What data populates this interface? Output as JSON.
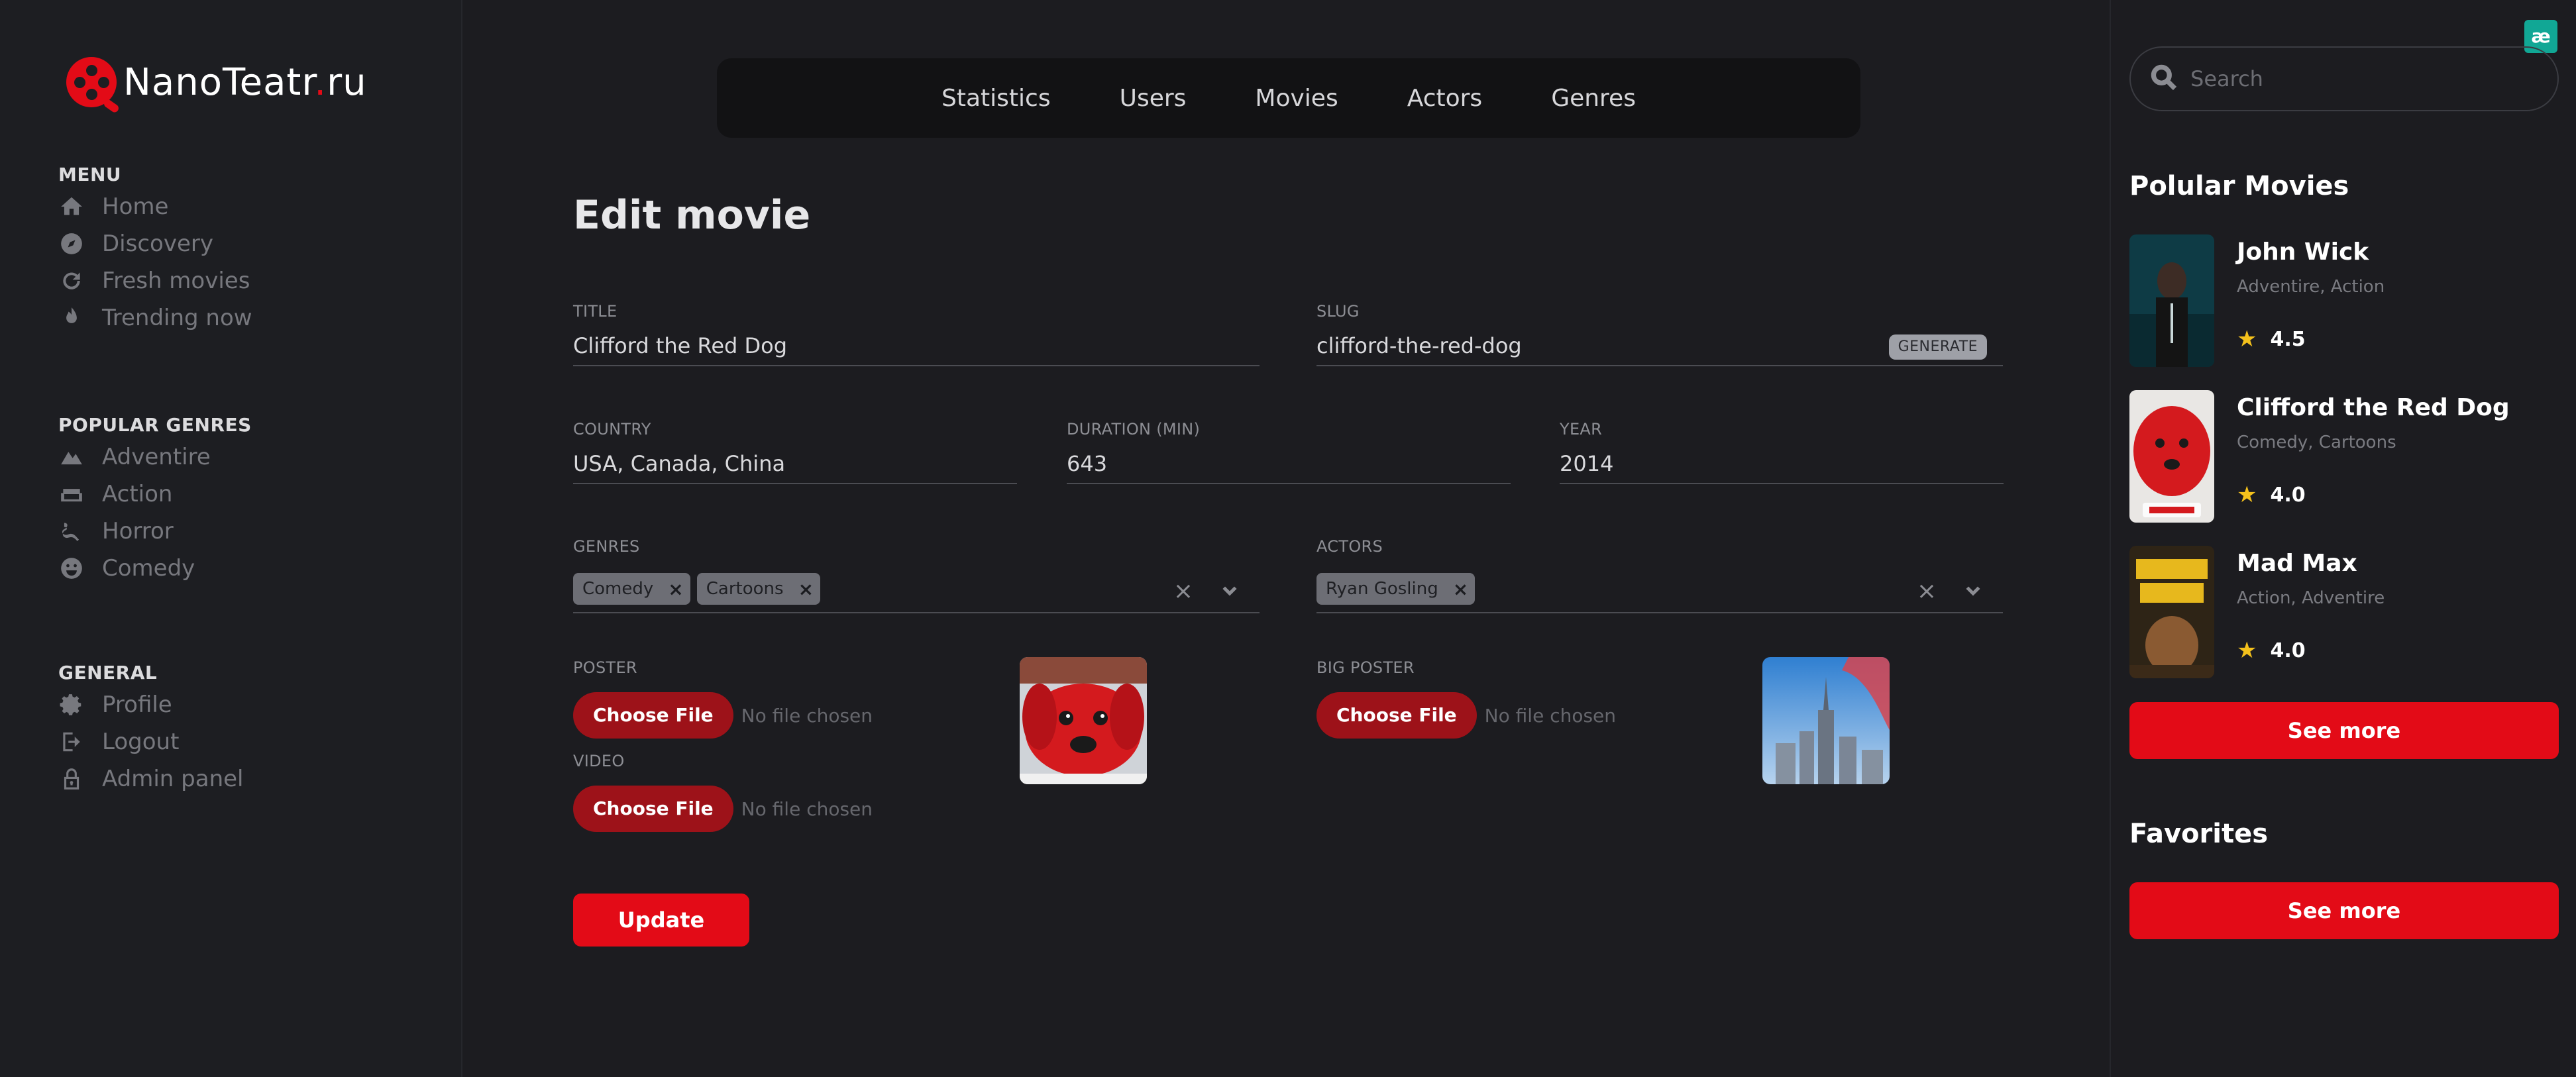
{
  "logo": {
    "name": "NanoTeatr",
    "dot": ".",
    "tld": "ru"
  },
  "sidebar": {
    "menu_heading": "MENU",
    "menu_items": [
      {
        "label": "Home",
        "icon": "home-icon"
      },
      {
        "label": "Discovery",
        "icon": "compass-icon"
      },
      {
        "label": "Fresh movies",
        "icon": "refresh-icon"
      },
      {
        "label": "Trending now",
        "icon": "fire-icon"
      }
    ],
    "genres_heading": "POPULAR GENRES",
    "genre_items": [
      {
        "label": "Adventire",
        "icon": "mountain-icon"
      },
      {
        "label": "Action",
        "icon": "couch-icon"
      },
      {
        "label": "Horror",
        "icon": "squiggle-icon"
      },
      {
        "label": "Comedy",
        "icon": "smile-icon"
      }
    ],
    "general_heading": "GENERAL",
    "general_items": [
      {
        "label": "Profile",
        "icon": "gear-icon"
      },
      {
        "label": "Logout",
        "icon": "logout-icon"
      },
      {
        "label": "Admin panel",
        "icon": "lock-icon"
      }
    ]
  },
  "top_nav": [
    "Statistics",
    "Users",
    "Movies",
    "Actors",
    "Genres"
  ],
  "form": {
    "page_title": "Edit movie",
    "title_label": "TITLE",
    "title_value": "Clifford the Red Dog",
    "slug_label": "SLUG",
    "slug_value": "clifford-the-red-dog",
    "generate_label": "GENERATE",
    "country_label": "COUNTRY",
    "country_value": "USA, Canada, China",
    "duration_label": "DURATION (MIN)",
    "duration_value": "643",
    "year_label": "YEAR",
    "year_value": "2014",
    "genres_label": "GENRES",
    "genres_chips": [
      "Comedy",
      "Cartoons"
    ],
    "actors_label": "ACTORS",
    "actors_chips": [
      "Ryan Gosling"
    ],
    "chip_remove": "×",
    "clear_glyph": "×",
    "poster_label": "POSTER",
    "big_poster_label": "BIG POSTER",
    "video_label": "VIDEO",
    "choose_file": "Choose File",
    "no_file": "No file chosen",
    "update_label": "Update"
  },
  "right": {
    "badge": "æ",
    "search_placeholder": "Search",
    "popular_title": "Polular Movies",
    "movies": [
      {
        "title": "John Wick",
        "genres": "Adventire, Action",
        "rating": "4.5"
      },
      {
        "title": "Clifford the Red Dog",
        "genres": "Comedy, Cartoons",
        "rating": "4.0"
      },
      {
        "title": "Mad Max",
        "genres": "Action, Adventire",
        "rating": "4.0"
      }
    ],
    "star_glyph": "★",
    "see_more": "See more",
    "favorites_title": "Favorites"
  },
  "colors": {
    "accent": "#e30b17",
    "background": "#1c1c20",
    "nav_bg": "#121214",
    "muted_text": "#77787e",
    "star": "#f4c11c"
  }
}
